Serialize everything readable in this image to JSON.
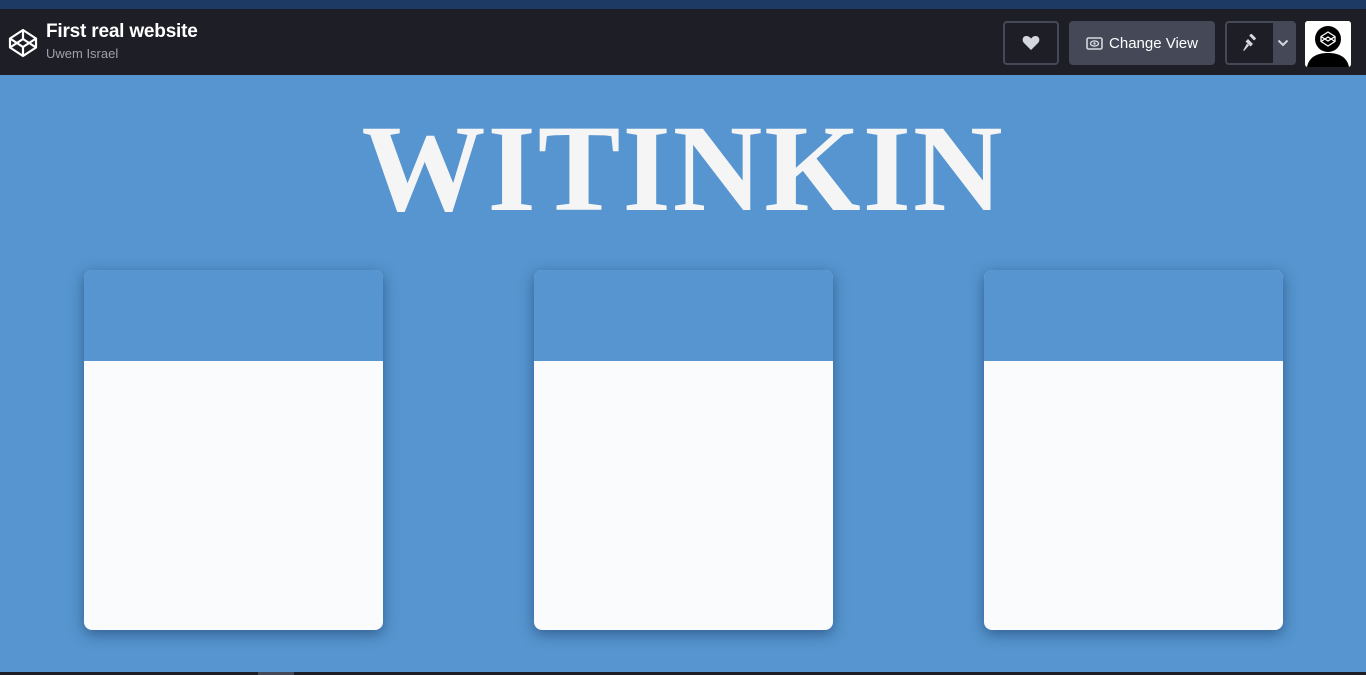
{
  "header": {
    "pen_title": "First real website",
    "author": "Uwem Israel",
    "logo_icon": "codepen-logo-icon",
    "actions": {
      "heart_icon": "heart-icon",
      "change_view_label": "Change View",
      "change_view_icon": "eye-icon",
      "pin_icon": "pin-icon",
      "pin_menu_icon": "chevron-down-icon"
    }
  },
  "preview": {
    "site_title": "WITINKIN",
    "cards": [
      {
        "id": "card-1"
      },
      {
        "id": "card-2"
      },
      {
        "id": "card-3"
      }
    ]
  },
  "colors": {
    "header_bg": "#1e1f26",
    "top_strip": "#1d3a64",
    "page_bg": "#5695cf",
    "card_body": "#fafbfc",
    "title_text": "#f5f5f5"
  }
}
